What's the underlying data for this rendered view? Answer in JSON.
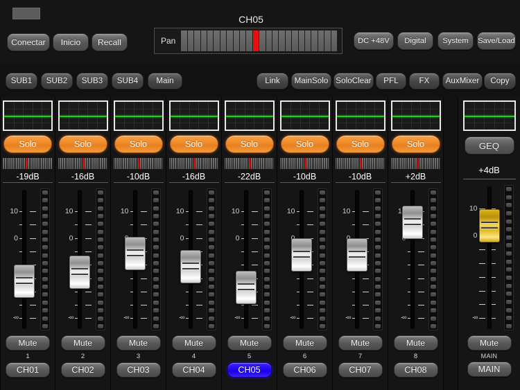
{
  "header": {
    "channel_title": "CH05",
    "status_indicator": "connection-led",
    "buttons": {
      "conectar": "Conectar",
      "inicio": "Inicio",
      "recall": "Recall",
      "dc48v": "DC  +48V",
      "digital": "Digital",
      "system": "System",
      "saveload": "Save/Load"
    },
    "pan": {
      "label": "Pan",
      "ticks": 24,
      "active_index": 11,
      "active_color": "#ee0d0d"
    }
  },
  "subbar": {
    "left": [
      {
        "label": "SUB1",
        "name": "sub1"
      },
      {
        "label": "SUB2",
        "name": "sub2"
      },
      {
        "label": "SUB3",
        "name": "sub3"
      },
      {
        "label": "SUB4",
        "name": "sub4"
      },
      {
        "label": "Main",
        "name": "main"
      }
    ],
    "right": [
      {
        "label": "Link",
        "name": "link"
      },
      {
        "label": "MainSolo",
        "name": "mainsolo"
      },
      {
        "label": "SoloClear",
        "name": "soloclear"
      },
      {
        "label": "PFL",
        "name": "pfl"
      },
      {
        "label": "FX",
        "name": "fx"
      },
      {
        "label": "AuxMixer",
        "name": "auxmixer"
      },
      {
        "label": "Copy",
        "name": "copy"
      }
    ]
  },
  "scale": {
    "top_label": "10",
    "mid_label": "0",
    "bottom_label": "-∞"
  },
  "labels": {
    "solo": "Solo",
    "mute": "Mute",
    "geq": "GEQ"
  },
  "colors": {
    "solo_active": "#f08a28",
    "selected_channel": "#2a0ef6",
    "eq_curve": "#18d418",
    "pan_indicator": "#ee0d0d",
    "main_fader": "#ddb71f",
    "panel_bg": "#151516"
  },
  "channels": [
    {
      "num": "1",
      "name": "CH01",
      "db": "-19dB",
      "solo": "Solo",
      "mute": "Mute",
      "fader_pct": 62,
      "trim_pct": 46,
      "solo_on": true,
      "selected": false
    },
    {
      "num": "2",
      "name": "CH02",
      "db": "-16dB",
      "solo": "Solo",
      "mute": "Mute",
      "fader_pct": 56,
      "trim_pct": 50,
      "solo_on": true,
      "selected": false
    },
    {
      "num": "3",
      "name": "CH03",
      "db": "-10dB",
      "solo": "Solo",
      "mute": "Mute",
      "fader_pct": 43,
      "trim_pct": 50,
      "solo_on": true,
      "selected": false
    },
    {
      "num": "4",
      "name": "CH04",
      "db": "-16dB",
      "solo": "Solo",
      "mute": "Mute",
      "fader_pct": 52,
      "trim_pct": 50,
      "solo_on": true,
      "selected": false
    },
    {
      "num": "5",
      "name": "CH05",
      "db": "-22dB",
      "solo": "Solo",
      "mute": "Mute",
      "fader_pct": 66,
      "trim_pct": 50,
      "solo_on": true,
      "selected": true
    },
    {
      "num": "6",
      "name": "CH06",
      "db": "-10dB",
      "solo": "Solo",
      "mute": "Mute",
      "fader_pct": 44,
      "trim_pct": 50,
      "solo_on": true,
      "selected": false
    },
    {
      "num": "7",
      "name": "CH07",
      "db": "-10dB",
      "solo": "Solo",
      "mute": "Mute",
      "fader_pct": 44,
      "trim_pct": 52,
      "solo_on": true,
      "selected": false
    },
    {
      "num": "8",
      "name": "CH08",
      "db": "+2dB",
      "solo": "Solo",
      "mute": "Mute",
      "fader_pct": 22,
      "trim_pct": 54,
      "solo_on": true,
      "selected": false
    }
  ],
  "master": {
    "geq": "GEQ",
    "db": "+4dB",
    "mute": "Mute",
    "sub_label": "MAIN",
    "name": "MAIN",
    "fader_pct": 26
  },
  "meter": {
    "led_count": 18
  }
}
